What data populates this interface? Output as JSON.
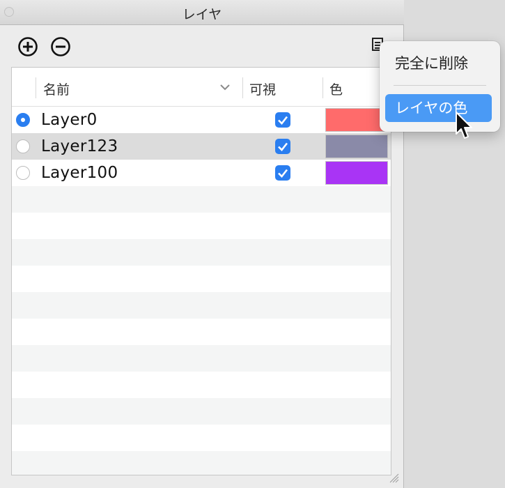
{
  "window": {
    "title": "レイヤ"
  },
  "toolbar": {
    "add_icon": "plus-circle-icon",
    "remove_icon": "minus-circle-icon",
    "details_icon": "list-icon"
  },
  "table": {
    "columns": {
      "name": "名前",
      "visible": "可視",
      "color": "色"
    },
    "rows": [
      {
        "name": "Layer0",
        "active": true,
        "visible": true,
        "color": "#ff6b6b"
      },
      {
        "name": "Layer123",
        "active": false,
        "visible": true,
        "color": "#8a8aa8"
      },
      {
        "name": "Layer100",
        "active": false,
        "visible": true,
        "color": "#a934f5"
      }
    ]
  },
  "context_menu": {
    "items": [
      {
        "label": "完全に削除"
      },
      {
        "label": "レイヤの色"
      }
    ],
    "highlighted": "レイヤの色"
  },
  "colors": {
    "accent": "#2a7ef0",
    "menu_highlight": "#4a9af5"
  }
}
